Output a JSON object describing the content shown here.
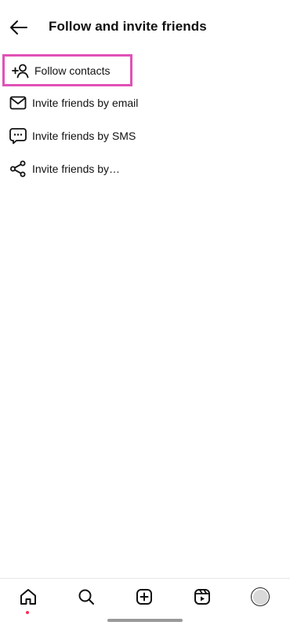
{
  "header": {
    "title": "Follow and invite friends",
    "back_icon": "arrow-left-icon"
  },
  "menu": {
    "items": [
      {
        "label": "Follow contacts",
        "icon": "person-add-icon",
        "highlighted": true
      },
      {
        "label": "Invite friends by email",
        "icon": "mail-icon"
      },
      {
        "label": "Invite friends by SMS",
        "icon": "chat-bubble-icon"
      },
      {
        "label": "Invite friends by…",
        "icon": "share-icon"
      }
    ]
  },
  "bottom_nav": {
    "items": [
      {
        "name": "home",
        "icon": "home-icon",
        "active": true
      },
      {
        "name": "search",
        "icon": "search-icon"
      },
      {
        "name": "create",
        "icon": "plus-square-icon"
      },
      {
        "name": "reels",
        "icon": "reels-icon"
      },
      {
        "name": "profile",
        "icon": "avatar"
      }
    ]
  },
  "colors": {
    "highlight_border": "#e051b6",
    "active_dot": "#ff2d55",
    "text": "#111111",
    "background": "#ffffff"
  }
}
